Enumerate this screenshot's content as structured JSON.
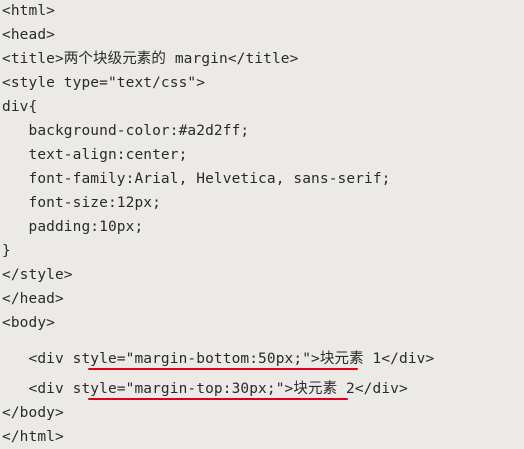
{
  "code": {
    "lines": [
      "<html>",
      "<head>",
      "<title>两个块级元素的 margin</title>",
      "<style type=\"text/css\">",
      "div{",
      "   background-color:#a2d2ff;",
      "   text-align:center;",
      "   font-family:Arial, Helvetica, sans-serif;",
      "   font-size:12px;",
      "   padding:10px;",
      "}",
      "</style>",
      "</head>",
      "<body>",
      "   <div style=\"margin-bottom:50px;\">块元素 1</div>",
      "   <div style=\"margin-top:30px;\">块元素 2</div>",
      "</body>",
      "</html>"
    ]
  },
  "highlights": {
    "color": "#e0001b"
  }
}
